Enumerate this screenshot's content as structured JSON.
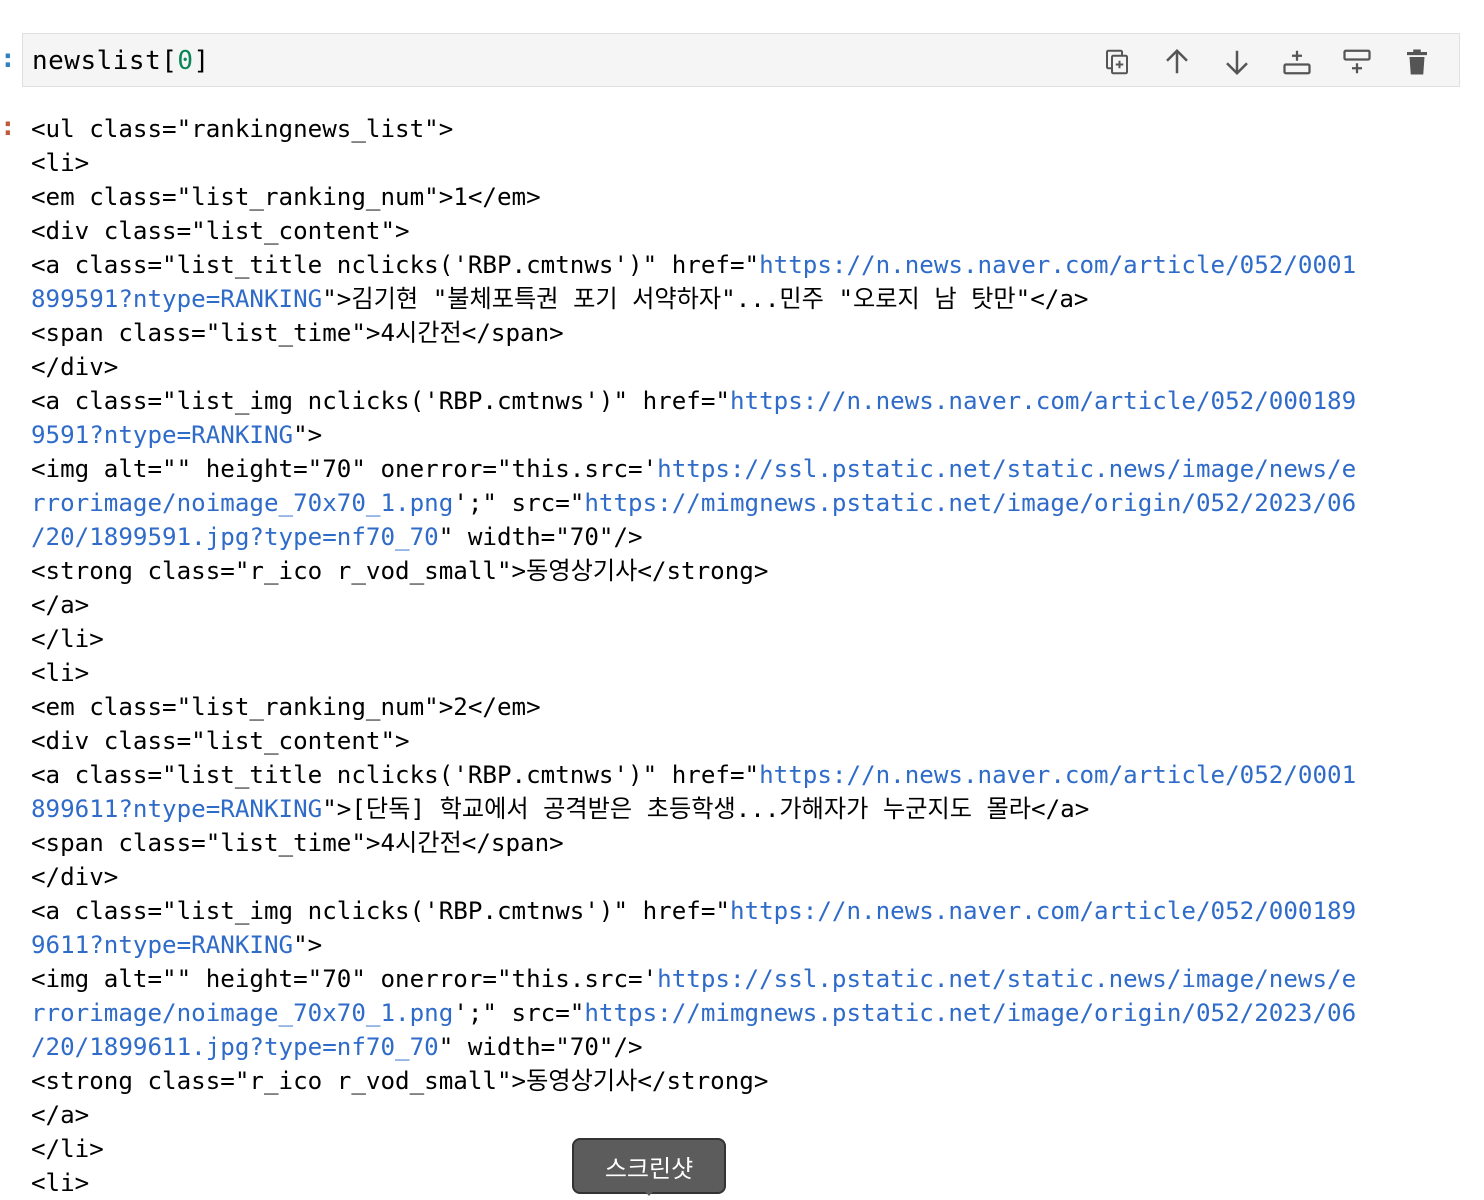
{
  "cell": {
    "in_marker": ":",
    "out_marker": ":",
    "input_code": {
      "prefix": "newslist[",
      "index": "0",
      "suffix": "]"
    }
  },
  "toolbar": {
    "buttons": [
      {
        "icon": "duplicate-icon"
      },
      {
        "icon": "arrow-up-icon"
      },
      {
        "icon": "arrow-down-icon"
      },
      {
        "icon": "insert-above-icon"
      },
      {
        "icon": "insert-below-icon"
      },
      {
        "icon": "trash-icon"
      }
    ]
  },
  "output_lines": [
    {
      "t": "<ul class=\"rankingnews_list\">"
    },
    {
      "t": "<li>"
    },
    {
      "t": "<em class=\"list_ranking_num\">1</em>"
    },
    {
      "t": "<div class=\"list_content\">"
    },
    {
      "pre": "<a class=\"list_title nclicks('RBP.cmtnws')\" href=\"",
      "url": "https://n.news.naver.com/article/052/0001"
    },
    {
      "url": "899591?ntype=RANKING",
      "post": "\">김기현 \"불체포특권 포기 서약하자\"...민주 \"오로지 남 탓만\"</a>"
    },
    {
      "t": "<span class=\"list_time\">4시간전</span>"
    },
    {
      "t": "</div>"
    },
    {
      "pre": "<a class=\"list_img nclicks('RBP.cmtnws')\" href=\"",
      "url": "https://n.news.naver.com/article/052/000189"
    },
    {
      "url": "9591?ntype=RANKING",
      "post": "\">"
    },
    {
      "pre": "<img alt=\"\" height=\"70\" onerror=\"this.src='",
      "url": "https://ssl.pstatic.net/static.news/image/news/e"
    },
    {
      "url": "rrorimage/noimage_70x70_1.png",
      "post": "';\" src=\"",
      "url2": "https://mimgnews.pstatic.net/image/origin/052/2023/06"
    },
    {
      "url": "/20/1899591.jpg?type=nf70_70",
      "post": "\" width=\"70\"/>"
    },
    {
      "t": "<strong class=\"r_ico r_vod_small\">동영상기사</strong>"
    },
    {
      "t": "</a>"
    },
    {
      "t": "</li>"
    },
    {
      "t": "<li>"
    },
    {
      "t": "<em class=\"list_ranking_num\">2</em>"
    },
    {
      "t": "<div class=\"list_content\">"
    },
    {
      "pre": "<a class=\"list_title nclicks('RBP.cmtnws')\" href=\"",
      "url": "https://n.news.naver.com/article/052/0001"
    },
    {
      "url": "899611?ntype=RANKING",
      "post": "\">[단독] 학교에서 공격받은 초등학생...가해자가 누군지도 몰라</a>"
    },
    {
      "t": "<span class=\"list_time\">4시간전</span>"
    },
    {
      "t": "</div>"
    },
    {
      "pre": "<a class=\"list_img nclicks('RBP.cmtnws')\" href=\"",
      "url": "https://n.news.naver.com/article/052/000189"
    },
    {
      "url": "9611?ntype=RANKING",
      "post": "\">"
    },
    {
      "pre": "<img alt=\"\" height=\"70\" onerror=\"this.src='",
      "url": "https://ssl.pstatic.net/static.news/image/news/e"
    },
    {
      "url": "rrorimage/noimage_70x70_1.png",
      "post": "';\" src=\"",
      "url2": "https://mimgnews.pstatic.net/image/origin/052/2023/06"
    },
    {
      "url": "/20/1899611.jpg?type=nf70_70",
      "post": "\" width=\"70\"/>"
    },
    {
      "t": "<strong class=\"r_ico r_vod_small\">동영상기사</strong>"
    },
    {
      "t": "</a>"
    },
    {
      "t": "</li>"
    },
    {
      "t": "<li>"
    }
  ],
  "tooltip": {
    "label": "스크린샷"
  },
  "colors": {
    "url": "#2f6bc9",
    "number": "#098658",
    "in_marker": "#307fc1",
    "out_marker": "#bf5b3d"
  }
}
